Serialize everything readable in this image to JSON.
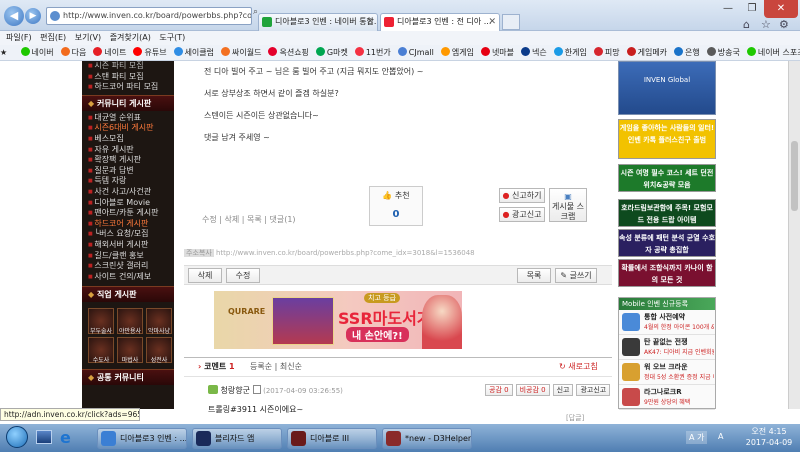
{
  "browser": {
    "address": "http://www.inven.co.kr/board/powerbbs.php?come_i",
    "tabs": [
      {
        "label": "디아블로3 인벤 : 네이버 통합...",
        "active": false
      },
      {
        "label": "디아블로3 인벤 : 전 디아 ...",
        "active": true
      }
    ],
    "window_controls": [
      "—",
      "❐",
      "✕"
    ],
    "toolbar_icons": [
      "⌂",
      "☆",
      "⚙"
    ]
  },
  "menu": [
    "파일(F)",
    "편집(E)",
    "보기(V)",
    "즐겨찾기(A)",
    "도구(T)"
  ],
  "favorites": [
    {
      "label": "네이버",
      "color": "#1ec800"
    },
    {
      "label": "다음",
      "color": "#f26b1d"
    },
    {
      "label": "네이트",
      "color": "#e61e25"
    },
    {
      "label": "유튜브",
      "color": "#ff0000"
    },
    {
      "label": "세이클럽",
      "color": "#2f8de4"
    },
    {
      "label": "싸이월드",
      "color": "#f37021"
    },
    {
      "label": "옥션쇼핑",
      "color": "#e4002b"
    },
    {
      "label": "G마켓",
      "color": "#00a650"
    },
    {
      "label": "11번가",
      "color": "#f43142"
    },
    {
      "label": "CJmall",
      "color": "#4a7fd4"
    },
    {
      "label": "엠게임",
      "color": "#ff9900"
    },
    {
      "label": "넷마블",
      "color": "#e60012"
    },
    {
      "label": "넥슨",
      "color": "#0c3b8a"
    },
    {
      "label": "한게임",
      "color": "#1a9be6"
    },
    {
      "label": "피망",
      "color": "#d6262e"
    },
    {
      "label": "게임메카",
      "color": "#c81e1e"
    },
    {
      "label": "은행",
      "color": "#1a73c9"
    },
    {
      "label": "방송국",
      "color": "#5a5a5a"
    },
    {
      "label": "네이버 스포츠",
      "color": "#1ec800"
    }
  ],
  "sidebar": {
    "top_items": [
      "시즌 파티 모집",
      "스탠 파티 모집",
      "하드코어 파티 모집"
    ],
    "community_head": "커뮤니티 게시판",
    "community_items": [
      {
        "label": "대균열 순위표",
        "hot": false
      },
      {
        "label": "시즌6대비 게시판",
        "hot": true
      },
      {
        "label": "베스모집",
        "hot": false
      },
      {
        "label": "자유 게시판",
        "hot": false
      },
      {
        "label": "확장팩 게시판",
        "hot": false
      },
      {
        "label": "질문과 답변",
        "hot": false
      },
      {
        "label": "득템 자랑",
        "hot": false
      },
      {
        "label": "사건 사고/사건관",
        "hot": false
      },
      {
        "label": "디아블로 Movie",
        "hot": false
      },
      {
        "label": "팬아트/카툰 게시판",
        "hot": false
      },
      {
        "label": "하드코어 게시판",
        "hot": true
      },
      {
        "label": "└버스 요청/모집",
        "hot": false
      },
      {
        "label": "해외서버 게시판",
        "hot": false
      },
      {
        "label": "길드/클랜 홍보",
        "hot": false
      },
      {
        "label": "스크린샷 갤러리",
        "hot": false
      },
      {
        "label": "사이트 건의/제보",
        "hot": false
      }
    ],
    "job_head": "직업 게시판",
    "jobs": [
      "부두술사",
      "야만용사",
      "악마사냥꾼",
      "수도사",
      "마법사",
      "성전사"
    ],
    "common_head": "공통 커뮤니티"
  },
  "post": {
    "lines": [
      "전 디아 빌어 주고 ~ 님은 룸 빌어 주고 (지금 뭐지도 안뽑았어) ~",
      "서로 상부상조 하면서 같이 즐겜 하실분?",
      "스텐이든 시즌이든 상관없습니다~",
      "댓글 남겨 주세영 ~"
    ],
    "recommend_label": "추천",
    "recommend_count": "0",
    "report_label": "신고하기",
    "ad_report_label": "광고신고",
    "scrap_label": "게시물 스크랩",
    "edit_links": "수정 | 삭제 | 목록 | 댓글(1)",
    "short_url_label": "주소복사",
    "short_url": "http://www.inven.co.kr/board/powerbbs.php?come_idx=3018&l=1536048",
    "delete_btn": "삭제",
    "modify_btn": "수정",
    "list_btn": "목록",
    "write_btn": "글쓰기"
  },
  "banner": {
    "tag": "치고 등급",
    "headline": "SSR마도서가",
    "sub": "내 손안에?!",
    "brand": "QURARE"
  },
  "comments": {
    "title": "코멘트",
    "count": "1",
    "sort1": "등록순",
    "sort2": "최신순",
    "refresh": "새로고침",
    "author": "청랑향군",
    "date": "(2017-04-09 03:26:55)",
    "actions": [
      "공감 0",
      "비공감 0",
      "신고",
      "광고신고"
    ],
    "text": "트롤링#3911  시즌이에요~",
    "reply": "[답글]"
  },
  "right_ads": [
    {
      "text": "INVEN Global",
      "bg": "#2d5ea8"
    },
    {
      "text": "게임을 좋아하는 사람들의 일터! 인벤 카톡 플러스친구 출범",
      "bg": "#f2c200"
    },
    {
      "text": "시즌 여명 필수 코스! 세트 던전 위치&공략 모음",
      "bg": "#1d7a2a"
    },
    {
      "text": "호라드림보관함에 주목! 모험모드 전용 드랍 아이템",
      "bg": "#0e4a1e"
    },
    {
      "text": "속성 분류에 패턴 분석 균열 수호자 공략 총집합",
      "bg": "#2a2060"
    },
    {
      "text": "확률에서 조합식까지 카나이 함의 모든 것",
      "bg": "#7a1030"
    }
  ],
  "mobile_box": {
    "title": "Mobile 인벤 신규등록",
    "items": [
      {
        "title": "통합 사전예약",
        "desc": "4월의 한정 아이콘 100개 & 10배 니"
      },
      {
        "title": "탄 끝없는 전쟁",
        "desc": "AK47: 디아비 지급 인벤회원은 10배 니"
      },
      {
        "title": "워 오브 크라운",
        "desc": "정대 5성 소환권 증정 지금 이벤트 사전"
      },
      {
        "title": "라그나로크R",
        "desc": "9만원 상당의 혜택"
      }
    ]
  },
  "status_tip": "http://adn.inven.co.kr/click?ads=965380",
  "taskbar": {
    "items": [
      "디아블로3 인벤 : ...",
      "블리자드 앱",
      "디아블로 III",
      "*new - D3Helper ..."
    ],
    "time": "오전 4:15",
    "date": "2017-04-09",
    "ime": "A 가",
    "lang": "A"
  }
}
